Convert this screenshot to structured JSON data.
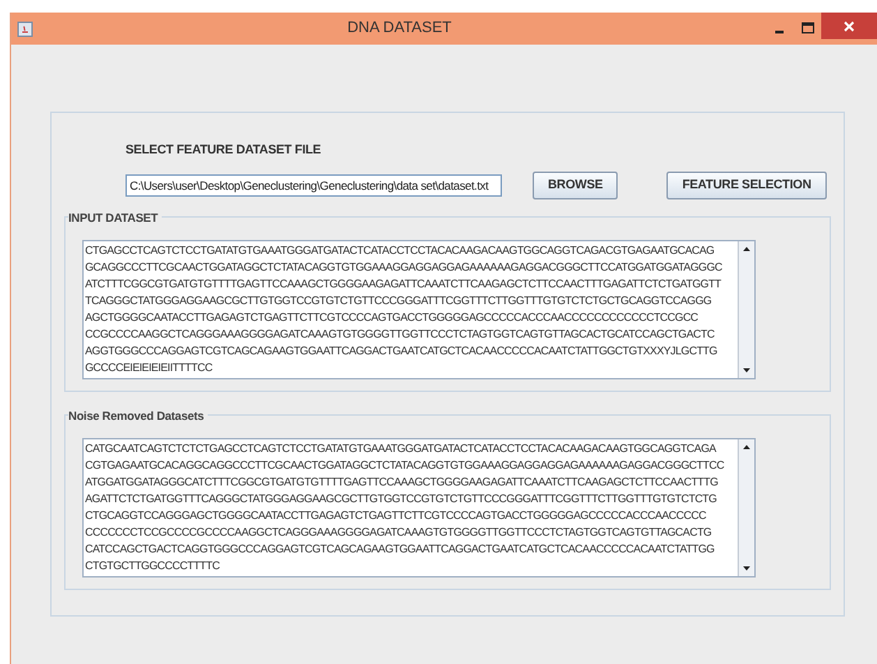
{
  "window": {
    "title": "DNA DATASET"
  },
  "file_section": {
    "label": "SELECT FEATURE DATASET FILE",
    "path": "C:\\Users\\user\\Desktop\\Geneclustering\\Geneclustering\\data set\\dataset.txt",
    "buttons": [
      "BROWSE",
      "FEATURE SELECTION"
    ]
  },
  "input_dataset": {
    "title": "INPUT DATASET",
    "lines": [
      "CTGAGCCTCAGTCTCCTGATATGTGAAATGGGATGATACTCATACCTCCTACACAAGACAAGTGGCAGGTCAGACGTGAGAATGCACAG",
      "GCAGGCCCTTCGCAACTGGATAGGCTCTATACAGGTGTGGAAAGGAGGAGGAGAAAAAAGAGGACGGGCTTCCATGGATGGATAGGGC",
      "ATCTTTCGGCGTGATGTGTTTTGAGTTCCAAAGCTGGGGAAGAGATTCAAATCTTCAAGAGCTCTTCCAACTTTGAGATTCTCTGATGGTT",
      "TCAGGGCTATGGGAGGAAGCGCTTGTGGTCCGTGTCTGTTCCCGGGATTTCGGTTTCTTGGTTTGTGTCTCTGCTGCAGGTCCAGGG",
      "AGCTGGGGCAATACCTTGAGAGTCTGAGTTCTTCGTCCCCAGTGACCTGGGGGAGCCCCCACCCAACCCCCCCCCCCCTCCGCC",
      "CCGCCCCAAGGCTCAGGGAAAGGGGAGATCAAAGTGTGGGGTTGGTTCCCTCTAGTGGTCAGTGTTAGCACTGCATCCAGCTGACTC",
      "AGGTGGGCCCAGGAGTCGTCAGCAGAAGTGGAATTCAGGACTGAATCATGCTCACAACCCCCACAATCTATTGGCTGTXXXYJLGCTTG",
      "GCCCCEIEIEIEIEIITTTTCC"
    ]
  },
  "noise_removed": {
    "title": "Noise Removed Datasets",
    "lines": [
      "CATGCAATCAGTCTCTCTGAGCCTCAGTCTCCTGATATGTGAAATGGGATGATACTCATACCTCCTACACAAGACAAGTGGCAGGTCAGA",
      "CGTGAGAATGCACAGGCAGGCCCTTCGCAACTGGATAGGCTCTATACAGGTGTGGAAAGGAGGAGGAGAAAAAAGAGGACGGGCTTCC",
      "ATGGATGGATAGGGCATCTTTCGGCGTGATGTGTTTTGAGTTCCAAAGCTGGGGAAGAGATTCAAATCTTCAAGAGCTCTTCCAACTTTG",
      "AGATTCTCTGATGGTTTCAGGGCTATGGGAGGAAGCGCTTGTGGTCCGTGTCTGTTCCCGGGATTTCGGTTTCTTGGTTTGTGTCTCTG",
      "CTGCAGGTCCAGGGAGCTGGGGCAATACCTTGAGAGTCTGAGTTCTTCGTCCCCAGTGACCTGGGGGAGCCCCCACCCAACCCCC",
      "CCCCCCCTCCGCCCCGCCCCAAGGCTCAGGGAAAGGGGAGATCAAAGTGTGGGGTTGGTTCCCTCTAGTGGTCAGTGTTAGCACTG",
      "CATCCAGCTGACTCAGGTGGGCCCAGGAGTCGTCAGCAGAAGTGGAATTCAGGACTGAATCATGCTCACAACCCCCACAATCTATTGG",
      "CTGTGCTTGGCCCCTTTTC"
    ]
  }
}
